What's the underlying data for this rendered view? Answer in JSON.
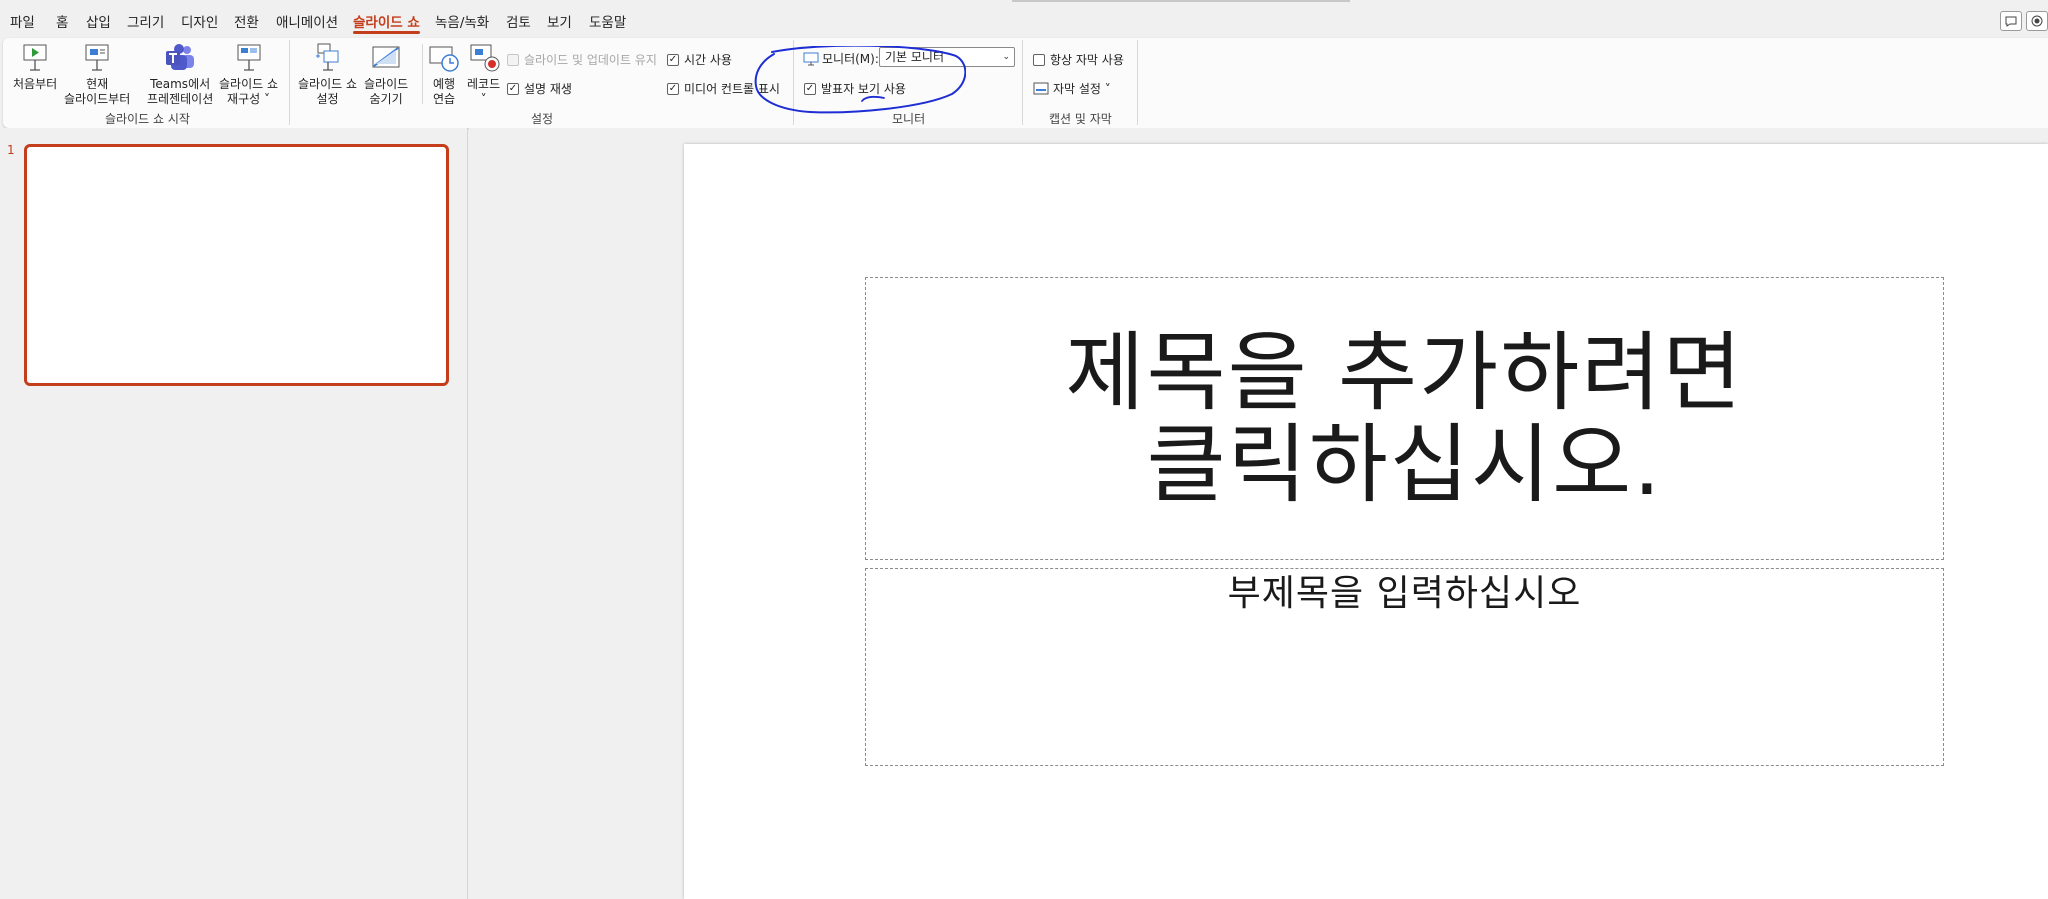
{
  "menu": {
    "tabs": [
      "파일",
      "홈",
      "삽입",
      "그리기",
      "디자인",
      "전환",
      "애니메이션",
      "슬라이드 쇼",
      "녹음/녹화",
      "검토",
      "보기",
      "도움말"
    ],
    "active_tab": "슬라이드 쇼"
  },
  "ribbon": {
    "start_group": {
      "label": "슬라이드 쇼 시작",
      "from_beginning": "처음부터",
      "from_current_1": "현재",
      "from_current_2": "슬라이드부터",
      "teams_1": "Teams에서",
      "teams_2": "프레젠테이션",
      "custom_1": "슬라이드 쇼",
      "custom_2": "재구성 ˅"
    },
    "setup_group": {
      "label": "설정",
      "setup_1": "슬라이드 쇼",
      "setup_2": "설정",
      "hide_1": "슬라이드",
      "hide_2": "숨기기",
      "rehearse_1": "예행",
      "rehearse_2": "연습",
      "record_1": "레코드",
      "record_2": "˅",
      "keep_updated": "슬라이드 및 업데이트 유지",
      "play_narrations": "설명 재생",
      "use_timings": "시간 사용",
      "show_media_controls": "미디어 컨트롤 표시"
    },
    "monitor_group": {
      "label": "모니터",
      "monitor_label": "모니터(M):",
      "monitor_value": "기본 모니터",
      "presenter_view": "발표자 보기 사용"
    },
    "captions_group": {
      "label": "캡션 및 자막",
      "always_subtitles": "항상 자막 사용",
      "subtitle_settings": "자막 설정 ˅"
    }
  },
  "slides": {
    "count_label": "1"
  },
  "slide": {
    "title_placeholder": "제목을 추가하려면 클릭하십시오.",
    "subtitle_placeholder": "부제목을 입력하십시오"
  },
  "colors": {
    "accent": "#c43e1c",
    "annotation": "#1e2ed4"
  }
}
